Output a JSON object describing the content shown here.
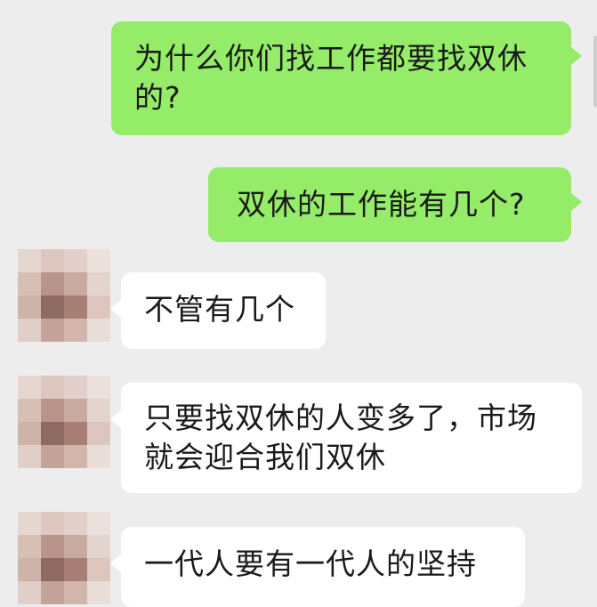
{
  "messages": [
    {
      "side": "out",
      "text": "为什么你们找工作都要找双休\n的?"
    },
    {
      "side": "out",
      "text": "双休的工作能有几个?"
    },
    {
      "side": "in",
      "text": "不管有几个"
    },
    {
      "side": "in",
      "text": "只要找双休的人变多了，市场\n就会迎合我们双休"
    },
    {
      "side": "in",
      "text": "一代人要有一代人的坚持"
    }
  ],
  "colors": {
    "background": "#ededed",
    "outgoing_bubble": "#95ec69",
    "incoming_bubble": "#ffffff"
  }
}
